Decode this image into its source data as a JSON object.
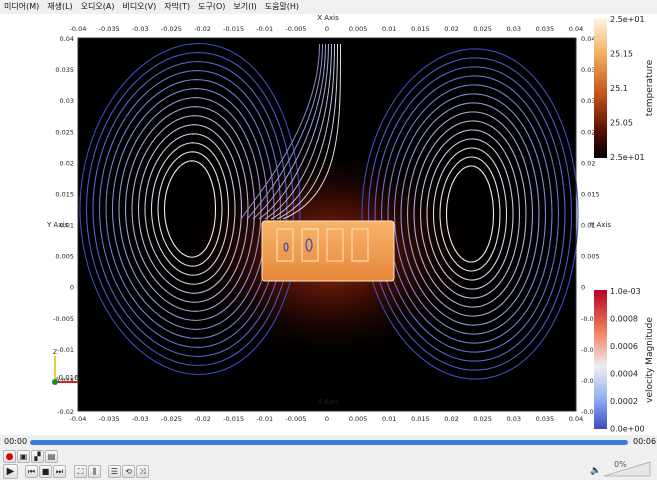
{
  "menu": [
    "미디어(M)",
    "재생(L)",
    "오디오(A)",
    "비디오(V)",
    "자막(T)",
    "도구(O)",
    "보기(I)",
    "도움말(H)"
  ],
  "axes": {
    "x_title": "X Axis",
    "y_title": "Y Axis",
    "x_ticks": [
      "-0.04",
      "-0.035",
      "-0.03",
      "-0.025",
      "-0.02",
      "-0.015",
      "-0.01",
      "-0.005",
      "0",
      "0.005",
      "0.01",
      "0.015",
      "0.02",
      "0.025",
      "0.03",
      "0.035",
      "0.04"
    ],
    "y_ticks": [
      "0.04",
      "0.035",
      "0.03",
      "0.025",
      "0.02",
      "0.015",
      "0.01",
      "0.005",
      "0",
      "-0.005",
      "-0.01",
      "-0.015",
      "-0.02"
    ]
  },
  "colorbars": {
    "temperature": {
      "title": "temperature",
      "labels": [
        "2.5e+01",
        "25.15",
        "25.1",
        "25.05",
        "2.5e+01"
      ]
    },
    "velocity": {
      "title": "velocity Magnitude",
      "labels": [
        "1.0e-03",
        "0.0008",
        "0.0006",
        "0.0004",
        "0.0002",
        "0.0e+00"
      ]
    }
  },
  "orientation": {
    "label": "-0.016"
  },
  "player": {
    "time_current": "00:00",
    "time_total": "00:06",
    "volume": "0%",
    "progress": 1.0,
    "buttons": [
      "record",
      "snapshot",
      "loop-ab",
      "frame-step",
      "play",
      "previous",
      "stop",
      "next",
      "fullscreen",
      "extended-settings",
      "playlist",
      "loop",
      "shuffle"
    ]
  },
  "colors": {
    "accent": "#3b7dd8",
    "background": "#000000",
    "streamline_low": "#3b4cc0",
    "streamline_high": "#f6efe8"
  }
}
